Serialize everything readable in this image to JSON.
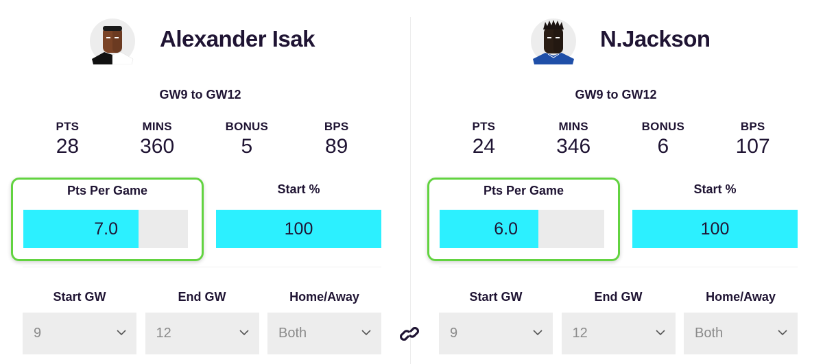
{
  "players": [
    {
      "name": "Alexander Isak",
      "avatar_icon": "player-avatar-icon",
      "shirt_colors": [
        "#111111",
        "#ffffff"
      ],
      "skin_color": "#7a4326",
      "range_label": "GW9 to GW12",
      "stats": [
        {
          "label": "PTS",
          "value": "28"
        },
        {
          "label": "MINS",
          "value": "360"
        },
        {
          "label": "BONUS",
          "value": "5"
        },
        {
          "label": "BPS",
          "value": "89"
        }
      ],
      "pts_per_game": {
        "title": "Pts Per Game",
        "value": "7.0",
        "fill_fraction": 0.7
      },
      "start_pct": {
        "title": "Start %",
        "value": "100",
        "fill_fraction": 1.0
      },
      "filters": [
        {
          "label": "Start GW",
          "value": "9"
        },
        {
          "label": "End GW",
          "value": "12"
        },
        {
          "label": "Home/Away",
          "value": "Both"
        }
      ]
    },
    {
      "name": "N.Jackson",
      "avatar_icon": "player-avatar-icon",
      "shirt_colors": [
        "#1f4fa8",
        "#1f4fa8"
      ],
      "skin_color": "#2a1d14",
      "range_label": "GW9 to GW12",
      "stats": [
        {
          "label": "PTS",
          "value": "24"
        },
        {
          "label": "MINS",
          "value": "346"
        },
        {
          "label": "BONUS",
          "value": "6"
        },
        {
          "label": "BPS",
          "value": "107"
        }
      ],
      "pts_per_game": {
        "title": "Pts Per Game",
        "value": "6.0",
        "fill_fraction": 0.6
      },
      "start_pct": {
        "title": "Start %",
        "value": "100",
        "fill_fraction": 1.0
      },
      "filters": [
        {
          "label": "Start GW",
          "value": "9"
        },
        {
          "label": "End GW",
          "value": "12"
        },
        {
          "label": "Home/Away",
          "value": "Both"
        }
      ]
    }
  ],
  "link_icon": "link-icon",
  "colors": {
    "text": "#1f1433",
    "bar_fill": "#2cf0ff",
    "bar_track": "#ebebeb",
    "highlight_border": "#62d340",
    "select_bg": "#ededed"
  }
}
